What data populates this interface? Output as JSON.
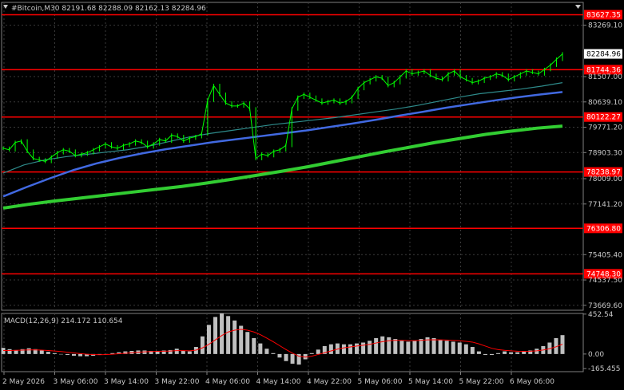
{
  "header": {
    "title": "#Bitcoin,M30  82191.68 82288.09 82162.13 82284.96",
    "macd_label": "MACD(12,26,9) 214.172 110.654"
  },
  "colors": {
    "background": "#000000",
    "grid": "#3a3a3a",
    "candle": "#00ff00",
    "sr_line": "#ff0000",
    "ma_fast": "#2e8b8b",
    "ma_mid": "#4169e1",
    "ma_slow": "#32cd32",
    "macd_hist": "#c0c0c0",
    "macd_signal": "#ff0000",
    "axis_text": "#c8c8c8",
    "price_tag_text": "#ffffff"
  },
  "chart_data": {
    "type": "line",
    "symbol": "#Bitcoin",
    "timeframe": "M30",
    "ohlc_last": {
      "open": 82191.68,
      "high": 82288.09,
      "low": 82162.13,
      "close": 82284.96
    },
    "current_price": "82284.96",
    "y_axis_ticks": [
      "83269.10",
      "81507.00",
      "80639.10",
      "79771.20",
      "78903.30",
      "78009.00",
      "77141.20",
      "75405.40",
      "74537.50",
      "73669.60"
    ],
    "x_axis_ticks": [
      "2 May 2026",
      "3 May 06:00",
      "3 May 14:00",
      "3 May 22:00",
      "4 May 06:00",
      "4 May 14:00",
      "4 May 22:00",
      "5 May 06:00",
      "5 May 14:00",
      "5 May 22:00",
      "6 May 06:00"
    ],
    "ylim": [
      73500,
      84050
    ],
    "horizontal_levels": [
      "83627.35",
      "81744.36",
      "80122.27",
      "78238.97",
      "76306.80",
      "74748.30"
    ],
    "series": [
      {
        "role": "price",
        "values": [
          79050,
          79000,
          79250,
          79300,
          78950,
          78700,
          78650,
          78600,
          78750,
          78900,
          79000,
          78950,
          78800,
          78850,
          78900,
          79000,
          79100,
          79200,
          79100,
          79050,
          79150,
          79200,
          79300,
          79250,
          79100,
          79200,
          79350,
          79300,
          79500,
          79450,
          79300,
          79400,
          79450,
          79550,
          80700,
          81200,
          80900,
          80600,
          80500,
          80500,
          80600,
          80400,
          78700,
          78850,
          78800,
          78950,
          79000,
          79150,
          80400,
          80800,
          80900,
          80800,
          80700,
          80600,
          80650,
          80700,
          80600,
          80650,
          80800,
          81100,
          81300,
          81400,
          81500,
          81450,
          81200,
          81300,
          81500,
          81700,
          81600,
          81650,
          81700,
          81550,
          81450,
          81400,
          81600,
          81700,
          81500,
          81400,
          81300,
          81350,
          81450,
          81500,
          81600,
          81550,
          81400,
          81500,
          81600,
          81700,
          81650,
          81600,
          81750,
          81900,
          82100,
          82284.96
        ]
      },
      {
        "role": "ma_fast",
        "values": [
          78200,
          78480,
          78650,
          78760,
          78840,
          78920,
          79000,
          79120,
          79280,
          79440,
          79560,
          79660,
          79760,
          79860,
          79940,
          80020,
          80100,
          80200,
          80300,
          80400,
          80520,
          80660,
          80800,
          80920,
          81000,
          81080,
          81180,
          81300
        ]
      },
      {
        "role": "ma_mid",
        "values": [
          77400,
          77720,
          78020,
          78300,
          78530,
          78720,
          78880,
          79020,
          79140,
          79260,
          79360,
          79460,
          79560,
          79660,
          79780,
          79900,
          80030,
          80170,
          80300,
          80440,
          80560,
          80680,
          80790,
          80890,
          80980
        ]
      },
      {
        "role": "ma_slow",
        "values": [
          77000,
          77130,
          77240,
          77340,
          77440,
          77540,
          77640,
          77740,
          77860,
          77990,
          78130,
          78270,
          78420,
          78590,
          78760,
          78930,
          79090,
          79250,
          79390,
          79530,
          79640,
          79740,
          79810
        ]
      }
    ],
    "macd": {
      "label": "MACD(12,26,9) 214.172 110.654",
      "value": 214.172,
      "signal_value": 110.654,
      "y_ticks": [
        "452.54",
        "0.00",
        "-165.455"
      ],
      "ylim": [
        -200,
        460
      ],
      "histogram": [
        70,
        55,
        45,
        55,
        65,
        55,
        40,
        25,
        10,
        0,
        -10,
        -20,
        -25,
        -25,
        -20,
        -10,
        0,
        10,
        20,
        30,
        35,
        40,
        40,
        35,
        30,
        40,
        45,
        60,
        40,
        30,
        80,
        200,
        330,
        420,
        460,
        430,
        380,
        320,
        250,
        180,
        120,
        60,
        10,
        -40,
        -80,
        -110,
        -120,
        -60,
        10,
        50,
        90,
        110,
        120,
        110,
        110,
        120,
        130,
        150,
        180,
        200,
        190,
        170,
        150,
        140,
        150,
        170,
        190,
        180,
        160,
        150,
        140,
        130,
        110,
        80,
        30,
        -10,
        -10,
        10,
        30,
        20,
        20,
        30,
        40,
        60,
        90,
        130,
        180,
        214.172
      ],
      "signal": [
        40,
        40,
        42,
        44,
        46,
        46,
        44,
        40,
        34,
        28,
        20,
        12,
        5,
        -2,
        -6,
        -8,
        -6,
        -2,
        3,
        8,
        14,
        20,
        25,
        28,
        30,
        32,
        34,
        38,
        38,
        36,
        44,
        70,
        110,
        160,
        210,
        250,
        270,
        280,
        270,
        250,
        220,
        180,
        140,
        95,
        50,
        10,
        -25,
        -35,
        -25,
        -5,
        15,
        35,
        55,
        70,
        80,
        90,
        100,
        110,
        125,
        140,
        150,
        155,
        155,
        152,
        152,
        155,
        160,
        162,
        160,
        158,
        155,
        150,
        144,
        135,
        115,
        90,
        65,
        50,
        42,
        36,
        32,
        30,
        32,
        36,
        45,
        60,
        82,
        110.654
      ]
    }
  }
}
